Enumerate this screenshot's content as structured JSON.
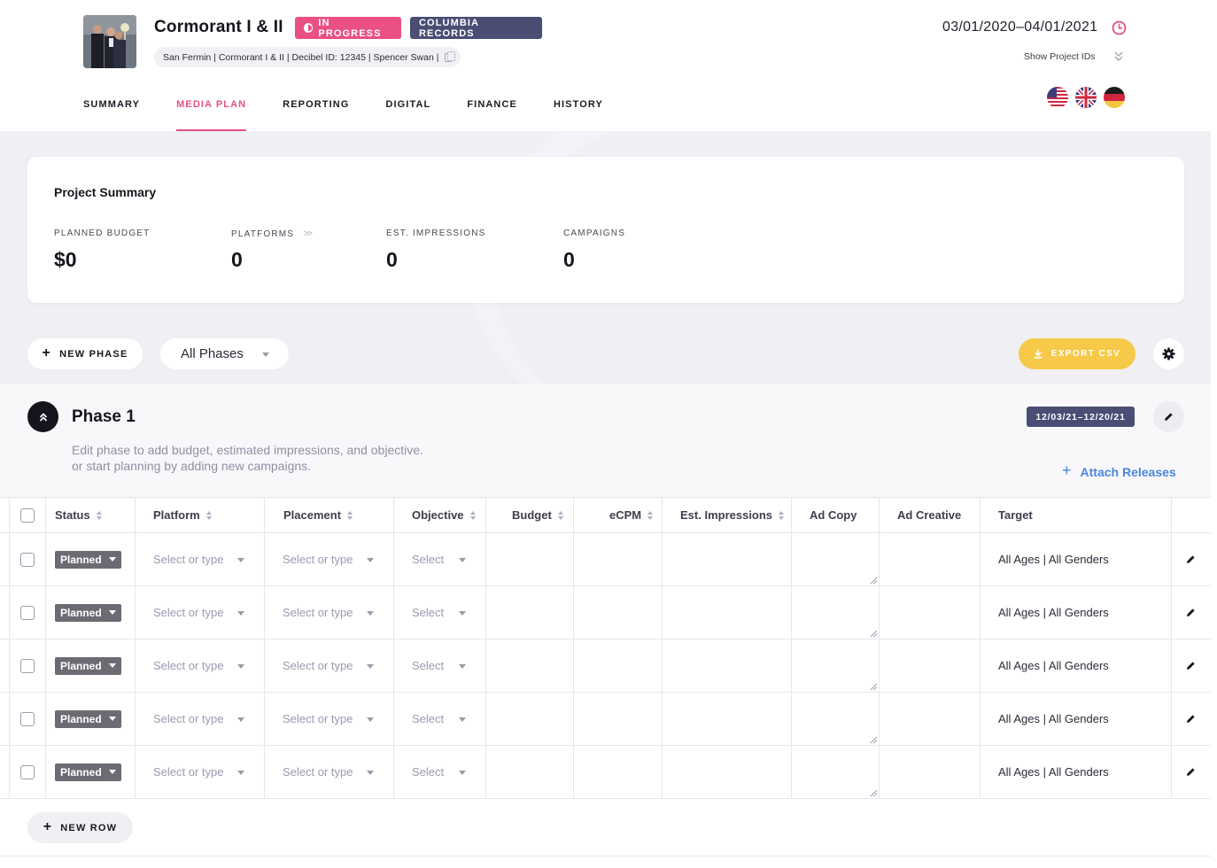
{
  "project": {
    "title": "Cormorant I & II",
    "status_badge": "IN PROGRESS",
    "label_badge": "COLUMBIA RECORDS",
    "meta": "San Fermin | Cormorant I & II | Decibel ID: 12345 | Spencer Swan |",
    "date_range": "03/01/2020–04/01/2021",
    "show_ids_label": "Show Project IDs"
  },
  "tabs": [
    {
      "label": "SUMMARY",
      "active": false
    },
    {
      "label": "MEDIA PLAN",
      "active": true
    },
    {
      "label": "REPORTING",
      "active": false
    },
    {
      "label": "DIGITAL",
      "active": false
    },
    {
      "label": "FINANCE",
      "active": false
    },
    {
      "label": "HISTORY",
      "active": false
    }
  ],
  "flags": [
    "us-flag-icon",
    "uk-flag-icon",
    "germany-flag-icon"
  ],
  "summary": {
    "title": "Project Summary",
    "stats": [
      {
        "label": "PLANNED BUDGET",
        "value": "$0"
      },
      {
        "label": "PLATFORMS",
        "value": "0"
      },
      {
        "label": "EST. IMPRESSIONS",
        "value": "0"
      },
      {
        "label": "CAMPAIGNS",
        "value": "0"
      }
    ]
  },
  "toolbar": {
    "new_phase_label": "NEW PHASE",
    "phase_filter_value": "All Phases",
    "export_label": "EXPORT CSV"
  },
  "phase": {
    "title": "Phase 1",
    "description_line1": "Edit phase to add budget, estimated impressions, and objective.",
    "description_line2": "or start planning by adding new campaigns.",
    "date_badge": "12/03/21–12/20/21",
    "attach_label": "Attach Releases"
  },
  "table": {
    "columns": [
      "Status",
      "Platform",
      "Placement",
      "Objective",
      "Budget",
      "eCPM",
      "Est. Impressions",
      "Ad Copy",
      "Ad Creative",
      "Target"
    ],
    "rows": [
      {
        "status": "Planned",
        "platform": "Select or type",
        "placement": "Select or type",
        "objective": "Select",
        "target": "All Ages | All Genders"
      },
      {
        "status": "Planned",
        "platform": "Select or type",
        "placement": "Select or type",
        "objective": "Select",
        "target": "All Ages | All Genders"
      },
      {
        "status": "Planned",
        "platform": "Select or type",
        "placement": "Select or type",
        "objective": "Select",
        "target": "All Ages | All Genders"
      },
      {
        "status": "Planned",
        "platform": "Select or type",
        "placement": "Select or type",
        "objective": "Select",
        "target": "All Ages | All Genders"
      },
      {
        "status": "Planned",
        "platform": "Select or type",
        "placement": "Select or type",
        "objective": "Select",
        "target": "All Ages | All Genders"
      }
    ],
    "new_row_label": "NEW ROW"
  },
  "colors": {
    "accent_pink": "#e54f88",
    "badge_navy": "#4a4d74",
    "export_yellow": "#f7c948",
    "link_blue": "#4a86e0"
  }
}
